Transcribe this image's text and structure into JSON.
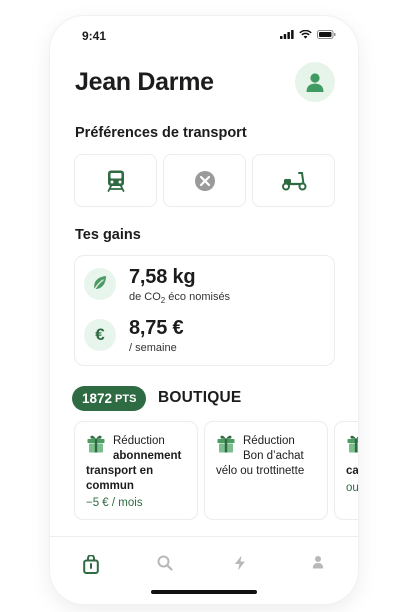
{
  "status_bar": {
    "time": "9:41"
  },
  "header": {
    "title": "Jean Darme"
  },
  "transport": {
    "title": "Préférences de transport",
    "options": [
      {
        "icon": "train-icon",
        "state": "selected"
      },
      {
        "icon": "close-icon",
        "state": "none"
      },
      {
        "icon": "scooter-icon",
        "state": "selected"
      }
    ]
  },
  "gains": {
    "title": "Tes gains",
    "co2": {
      "value": "7,58 kg",
      "label_prefix": "de CO",
      "label_sub": "2",
      "label_suffix": " éco nomisés",
      "icon": "leaf-icon"
    },
    "money": {
      "value": "8,75 €",
      "label": "/ semaine",
      "icon_symbol": "€"
    }
  },
  "shop": {
    "points_number": "1872",
    "points_unit": "PTS",
    "title": "BOUTIQUE",
    "items": [
      {
        "line1": "Réduction",
        "line2": "abonnement",
        "line3": "transport en commun",
        "price": "−5 € / mois"
      },
      {
        "line1": "Réduction",
        "line2": "Bon d’achat",
        "line3": "vélo ou trottinette",
        "price": ""
      },
      {
        "line1": "R",
        "line2": "",
        "line3": "ca",
        "price": "ou"
      }
    ]
  },
  "tab_bar": {
    "tabs": [
      {
        "icon": "shopping-bag-icon",
        "active": true
      },
      {
        "icon": "search-icon",
        "active": false
      },
      {
        "icon": "lightning-icon",
        "active": false
      },
      {
        "icon": "profile-icon",
        "active": false
      }
    ]
  },
  "colors": {
    "accent": "#2f6b42",
    "accent_light": "#e6f4ea",
    "inactive": "#b8b8b8"
  }
}
